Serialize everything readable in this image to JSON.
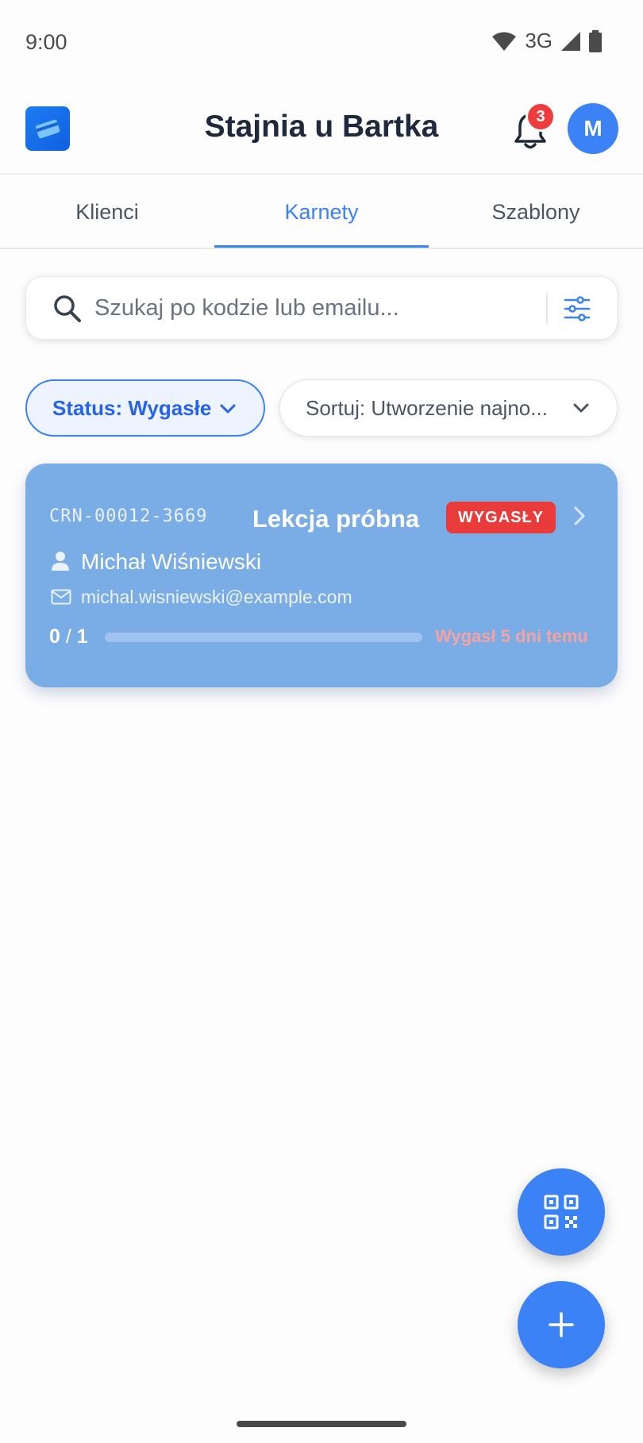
{
  "status_bar": {
    "time": "9:00",
    "network": "3G"
  },
  "header": {
    "title": "Stajnia u Bartka",
    "notifications_count": "3",
    "avatar_initial": "M"
  },
  "tabs": [
    {
      "label": "Klienci",
      "active": false
    },
    {
      "label": "Karnety",
      "active": true
    },
    {
      "label": "Szablony",
      "active": false
    }
  ],
  "search": {
    "placeholder": "Szukaj po kodzie lub emailu...",
    "value": ""
  },
  "filters": {
    "status_label": "Status: Wygasłe",
    "sort_label": "Sortuj: Utworzenie najno..."
  },
  "cards": [
    {
      "code": "CRN-00012-3669",
      "title": "Lekcja próbna",
      "badge": "WYGASŁY",
      "client_name": "Michał Wiśniewski",
      "email": "michal.wisniewski@example.com",
      "used": "0",
      "total": "1",
      "progress": 0,
      "expiry_text": "Wygasł 5 dni temu"
    }
  ],
  "colors": {
    "accent": "#3b82f6",
    "card_bg": "#7aace6",
    "badge_red": "#ea3b3b",
    "expiry_text": "#f3a3a3"
  },
  "icons": [
    "wifi-icon",
    "signal-icon",
    "battery-icon",
    "app-logo-icon",
    "bell-icon",
    "search-icon",
    "filter-icon",
    "chevron-down-icon",
    "chevron-right-icon",
    "person-icon",
    "mail-icon",
    "qr-code-icon",
    "plus-icon"
  ]
}
